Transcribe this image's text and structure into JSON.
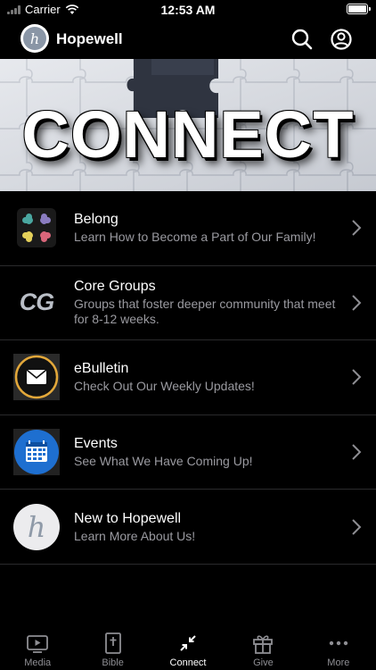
{
  "status_bar": {
    "carrier": "Carrier",
    "time": "12:53 AM"
  },
  "header": {
    "title": "Hopewell",
    "logo_letter": "h"
  },
  "banner": {
    "title": "CONNECT"
  },
  "items": [
    {
      "title": "Belong",
      "subtitle": "Learn How to Become a Part of Our Family!",
      "icon": "belong-cross-icon"
    },
    {
      "title": "Core Groups",
      "subtitle": "Groups that foster deeper community that meet for 8-12 weeks.",
      "icon": "cg-logo-icon",
      "icon_text": "CG"
    },
    {
      "title": "eBulletin",
      "subtitle": "Check Out Our Weekly Updates!",
      "icon": "envelope-icon"
    },
    {
      "title": "Events",
      "subtitle": "See What We Have Coming Up!",
      "icon": "calendar-icon"
    },
    {
      "title": "New to Hopewell",
      "subtitle": "Learn More About Us!",
      "icon": "hopewell-logo-icon",
      "icon_text": "h"
    }
  ],
  "tabs": [
    {
      "label": "Media",
      "icon": "media-play-icon",
      "active": false
    },
    {
      "label": "Bible",
      "icon": "bible-icon",
      "active": false
    },
    {
      "label": "Connect",
      "icon": "connect-arrows-icon",
      "active": true
    },
    {
      "label": "Give",
      "icon": "gift-icon",
      "active": false
    },
    {
      "label": "More",
      "icon": "more-dots-icon",
      "active": false
    }
  ],
  "colors": {
    "background": "#000000",
    "subtitle": "#9a9aa0",
    "tab_inactive": "#8e8e93",
    "divider": "#2a2a2c"
  }
}
